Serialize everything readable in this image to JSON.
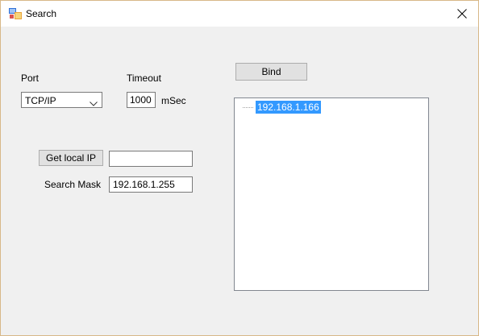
{
  "window": {
    "title": "Search",
    "close_symbol": "✕"
  },
  "labels": {
    "port": "Port",
    "timeout": "Timeout",
    "msec": "mSec",
    "search_mask": "Search Mask"
  },
  "port_combo": {
    "selected": "TCP/IP"
  },
  "timeout_input": {
    "value": "1000"
  },
  "local_ip_input": {
    "value": ""
  },
  "search_mask_input": {
    "value": "192.168.1.255"
  },
  "buttons": {
    "bind": "Bind",
    "get_local_ip": "Get local IP"
  },
  "tree": {
    "nodes": [
      {
        "label": "192.168.1.166",
        "selected": true
      }
    ]
  },
  "colors": {
    "selection": "#3399ff",
    "window_border": "#d8b888"
  },
  "icons": {
    "app": "app-window-icon",
    "close": "close-icon",
    "dropdown": "chevron-down-icon"
  }
}
